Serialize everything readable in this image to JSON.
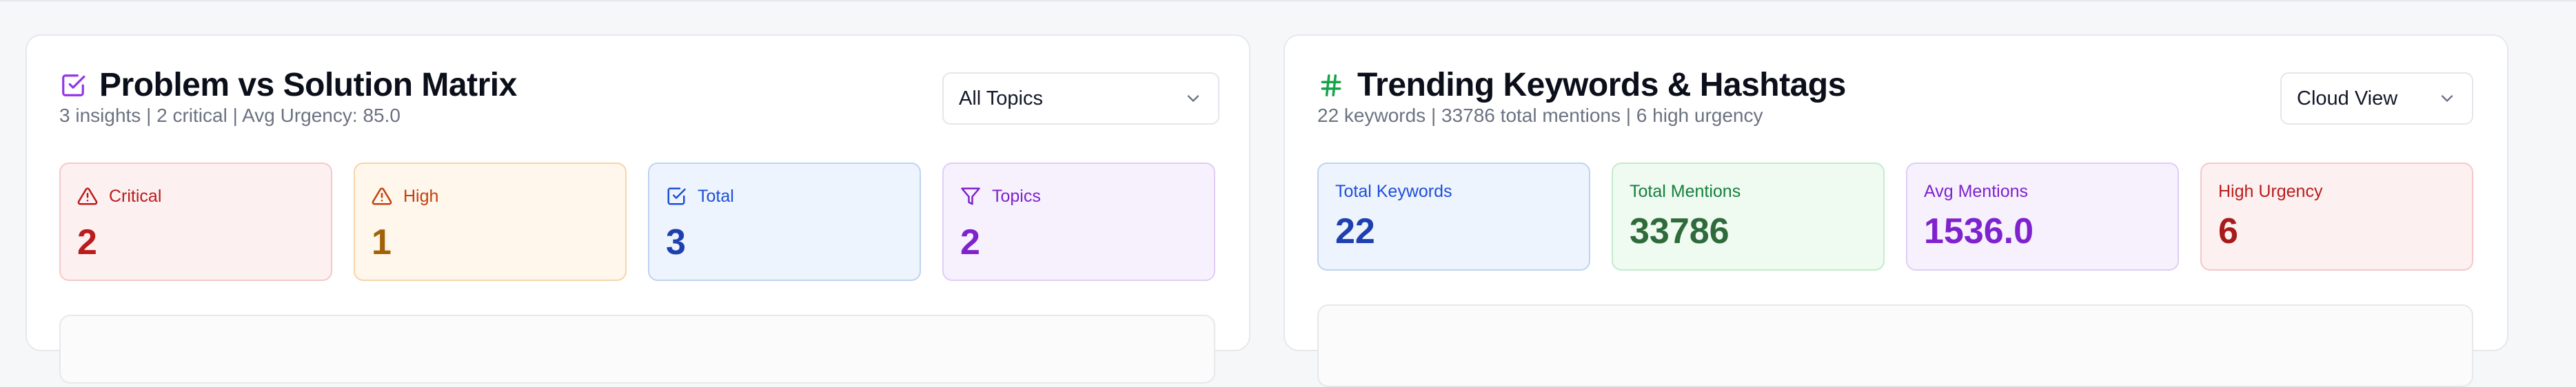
{
  "colors": {
    "critical": "#b91c1c",
    "high": "#c2410c",
    "total": "#1d4ed8",
    "topics": "#7e22ce",
    "mentions": "#15803d",
    "hashtag": "#16a34a"
  },
  "left_panel": {
    "title": "Problem vs Solution Matrix",
    "title_icon": "checkbox-icon",
    "subtitle": "3 insights | 2 critical | Avg Urgency: 85.0",
    "filter": {
      "selected": "All Topics"
    },
    "stats": [
      {
        "label": "Critical",
        "value": "2",
        "icon": "alert-triangle-icon"
      },
      {
        "label": "High",
        "value": "1",
        "icon": "alert-triangle-icon"
      },
      {
        "label": "Total",
        "value": "3",
        "icon": "checkbox-icon"
      },
      {
        "label": "Topics",
        "value": "2",
        "icon": "filter-icon"
      }
    ]
  },
  "right_panel": {
    "title": "Trending Keywords & Hashtags",
    "title_icon": "hash-icon",
    "subtitle": "22 keywords | 33786 total mentions | 6 high urgency",
    "view": {
      "selected": "Cloud View"
    },
    "stats": [
      {
        "label": "Total Keywords",
        "value": "22"
      },
      {
        "label": "Total Mentions",
        "value": "33786"
      },
      {
        "label": "Avg Mentions",
        "value": "1536.0"
      },
      {
        "label": "High Urgency",
        "value": "6"
      }
    ]
  }
}
